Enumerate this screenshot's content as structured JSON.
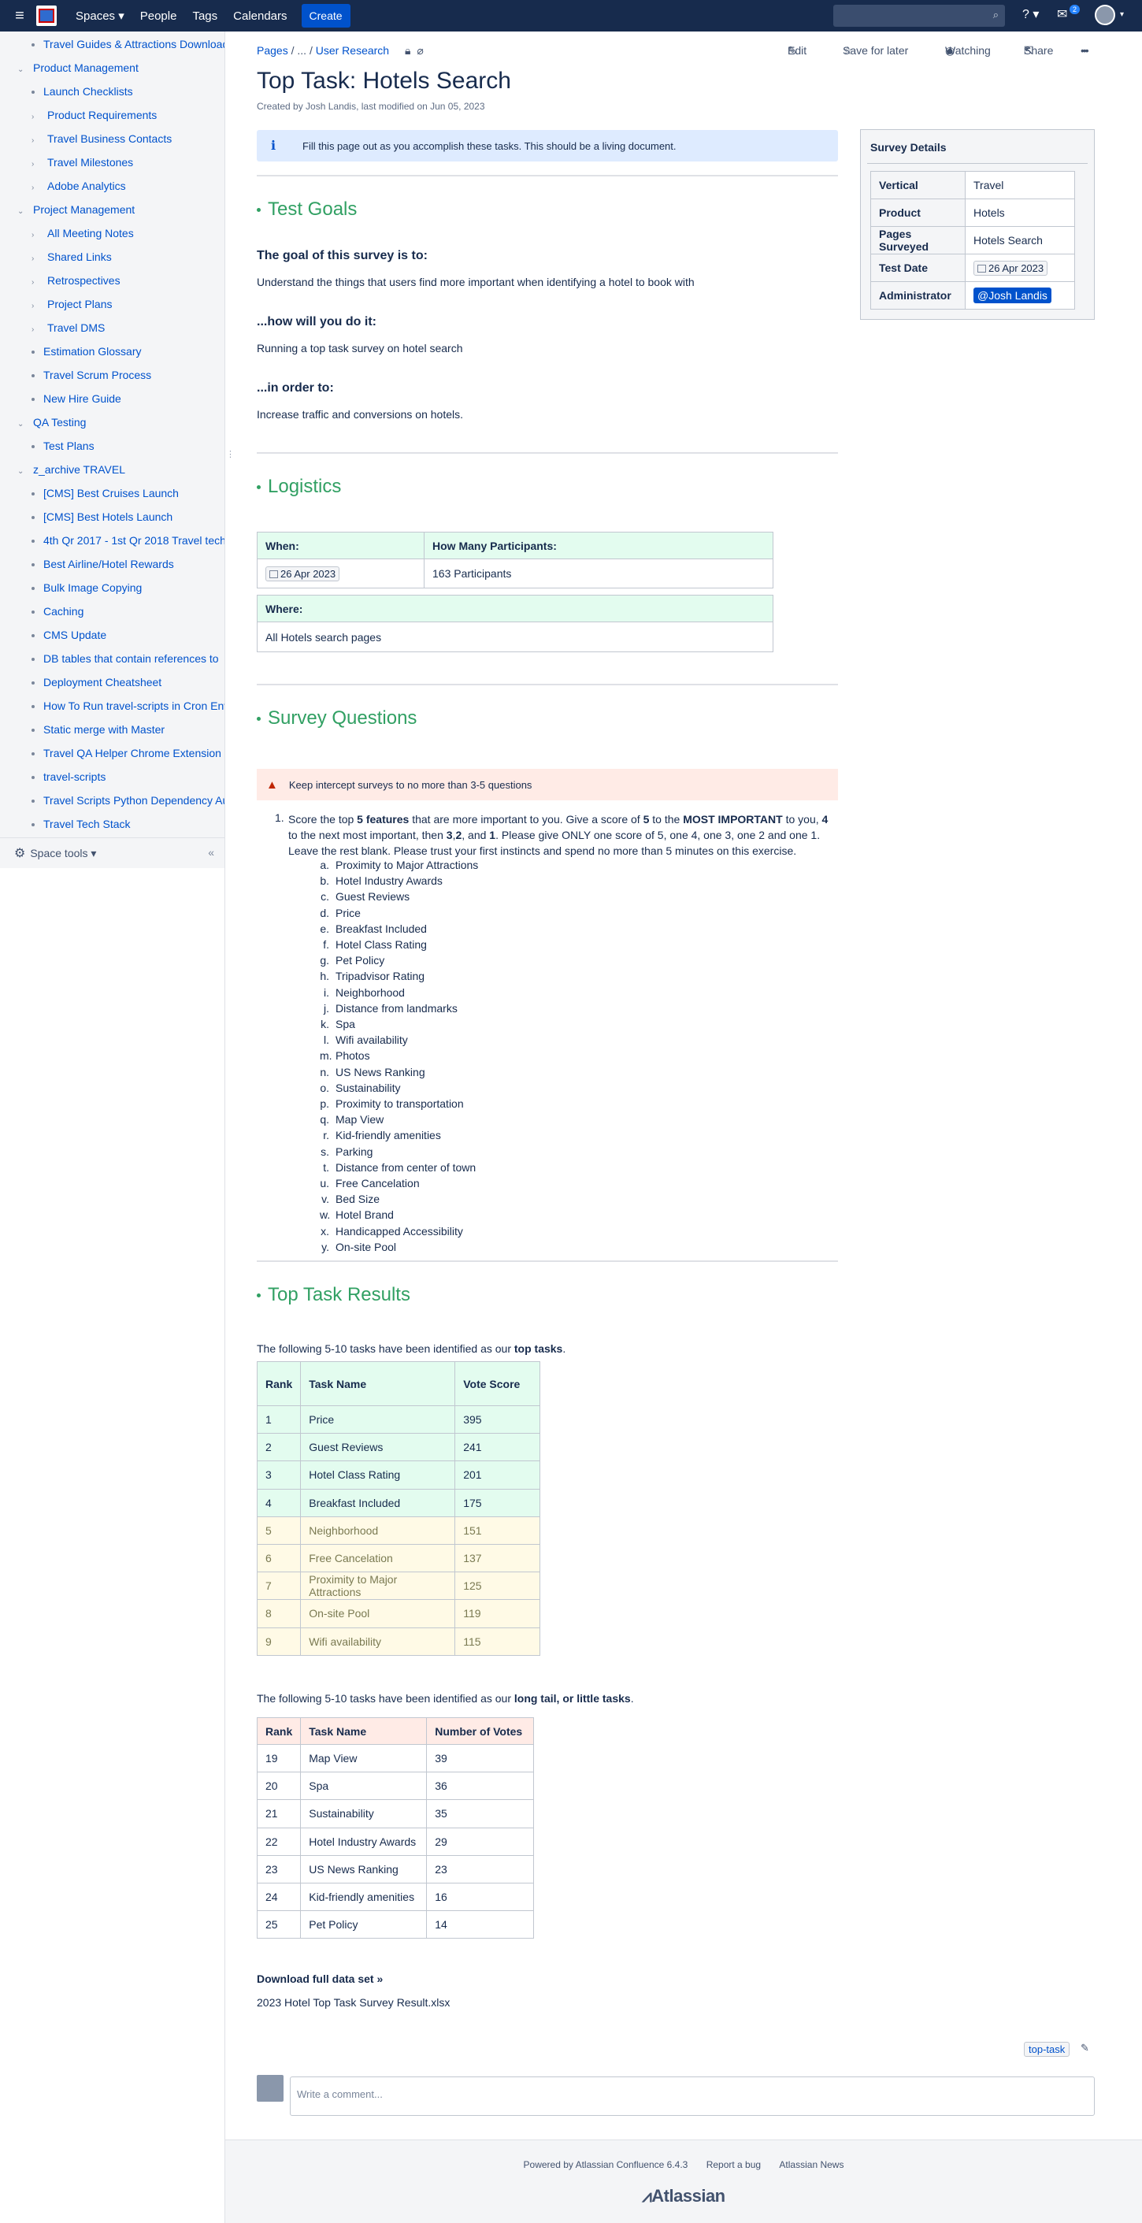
{
  "topbar": {
    "nav": [
      "Spaces ▾",
      "People",
      "Tags",
      "Calendars"
    ],
    "create_label": "Create",
    "notifications_count": "2",
    "help_label": "? ▾"
  },
  "sidebar": {
    "items": [
      {
        "label": "Travel Guides & Attractions Download",
        "level": 2,
        "kind": "bullet"
      },
      {
        "label": "Product Management",
        "level": 1,
        "kind": "open"
      },
      {
        "label": "Launch Checklists",
        "level": 2,
        "kind": "bullet"
      },
      {
        "label": "Product Requirements",
        "level": 2,
        "kind": "closed"
      },
      {
        "label": "Travel Business Contacts",
        "level": 2,
        "kind": "closed"
      },
      {
        "label": "Travel Milestones",
        "level": 2,
        "kind": "closed"
      },
      {
        "label": "Adobe Analytics",
        "level": 2,
        "kind": "closed"
      },
      {
        "label": "Project Management",
        "level": 1,
        "kind": "open"
      },
      {
        "label": "All Meeting Notes",
        "level": 2,
        "kind": "closed"
      },
      {
        "label": "Shared Links",
        "level": 2,
        "kind": "closed"
      },
      {
        "label": "Retrospectives",
        "level": 2,
        "kind": "closed"
      },
      {
        "label": "Project Plans",
        "level": 2,
        "kind": "closed"
      },
      {
        "label": "Travel DMS",
        "level": 2,
        "kind": "closed"
      },
      {
        "label": "Estimation Glossary",
        "level": 2,
        "kind": "bullet"
      },
      {
        "label": "Travel Scrum Process",
        "level": 2,
        "kind": "bullet"
      },
      {
        "label": "New Hire Guide",
        "level": 2,
        "kind": "bullet"
      },
      {
        "label": "QA Testing",
        "level": 1,
        "kind": "open"
      },
      {
        "label": "Test Plans",
        "level": 2,
        "kind": "bullet"
      },
      {
        "label": "z_archive TRAVEL",
        "level": 1,
        "kind": "open"
      },
      {
        "label": "[CMS] Best Cruises Launch",
        "level": 2,
        "kind": "bullet"
      },
      {
        "label": "[CMS] Best Hotels Launch",
        "level": 2,
        "kind": "bullet"
      },
      {
        "label": "4th Qr 2017 - 1st Qr 2018 Travel tech",
        "level": 2,
        "kind": "bullet"
      },
      {
        "label": "Best Airline/Hotel Rewards",
        "level": 2,
        "kind": "bullet"
      },
      {
        "label": "Bulk Image Copying",
        "level": 2,
        "kind": "bullet"
      },
      {
        "label": "Caching",
        "level": 2,
        "kind": "bullet"
      },
      {
        "label": "CMS Update",
        "level": 2,
        "kind": "bullet"
      },
      {
        "label": "DB tables that contain references to",
        "level": 2,
        "kind": "bullet"
      },
      {
        "label": "Deployment Cheatsheet",
        "level": 2,
        "kind": "bullet"
      },
      {
        "label": "How To Run travel-scripts in Cron Env",
        "level": 2,
        "kind": "bullet"
      },
      {
        "label": "Static merge with Master",
        "level": 2,
        "kind": "bullet"
      },
      {
        "label": "Travel QA Helper Chrome Extension",
        "level": 2,
        "kind": "bullet"
      },
      {
        "label": "travel-scripts",
        "level": 2,
        "kind": "bullet"
      },
      {
        "label": "Travel Scripts Python Dependency Au",
        "level": 2,
        "kind": "bullet"
      },
      {
        "label": "Travel Tech Stack",
        "level": 2,
        "kind": "bullet"
      }
    ],
    "space_tools": "Space tools ▾"
  },
  "page": {
    "breadcrumb": [
      "Pages",
      "...",
      "User Research"
    ],
    "actions": {
      "edit": "Edit",
      "save": "Save for later",
      "watching": "Watching",
      "share": "Share",
      "more": "•••"
    },
    "title": "Top Task: Hotels Search",
    "byline": "Created by Josh Landis, last modified on Jun 05, 2023",
    "info": "Fill this page out as you accomplish these tasks. This should be a living document.",
    "goals": {
      "heading": "Test Goals",
      "q1": "The goal of this survey is to:",
      "a1": "Understand the things that users find more important when identifying a hotel to book with",
      "q2": "...how will you do it:",
      "a2": "Running a top task survey on hotel search",
      "q3": "...in order to:",
      "a3": "Increase traffic and conversions on hotels."
    },
    "logistics": {
      "heading": "Logistics",
      "when_label": "When:",
      "participants_label": "How Many Participants:",
      "when_value": "26 Apr 2023",
      "participants_value": "163 Participants",
      "where_label": "Where:",
      "where_value": "All Hotels search pages"
    },
    "survey": {
      "heading": "Survey Questions",
      "warning": "Keep intercept surveys to no more than 3-5 questions",
      "q_number": "1.",
      "q_parts": [
        {
          "t": "Score the top ",
          "b": false
        },
        {
          "t": "5 features",
          "b": true
        },
        {
          "t": " that are more important to you. Give a score of ",
          "b": false
        },
        {
          "t": "5",
          "b": true
        },
        {
          "t": " to the ",
          "b": false
        },
        {
          "t": "MOST IMPORTANT",
          "b": true
        },
        {
          "t": " to you, ",
          "b": false
        },
        {
          "t": "4",
          "b": true
        },
        {
          "t": " to the next most important, then ",
          "b": false
        },
        {
          "t": "3",
          "b": true
        },
        {
          "t": ",",
          "b": false
        },
        {
          "t": "2",
          "b": true
        },
        {
          "t": ", and ",
          "b": false
        },
        {
          "t": "1",
          "b": true
        },
        {
          "t": ". Please give ONLY one score of 5, one 4, one 3, one 2 and one 1.  Leave the rest blank. Please trust your first instincts and spend no more than  5 minutes on this exercise.",
          "b": false
        }
      ],
      "letters": [
        "a.",
        "b.",
        "c.",
        "d.",
        "e.",
        "f.",
        "g.",
        "h.",
        "i.",
        "j.",
        "k.",
        "l.",
        "m.",
        "n.",
        "o.",
        "p.",
        "q.",
        "r.",
        "s.",
        "t.",
        "u.",
        "v.",
        "w.",
        "x.",
        "y."
      ],
      "options": [
        "Proximity to Major Attractions",
        "Hotel Industry Awards",
        "Guest Reviews",
        "Price",
        "Breakfast Included",
        "Hotel Class Rating",
        "Pet Policy",
        "Tripadvisor Rating",
        "Neighborhood",
        "Distance from landmarks",
        "Spa",
        "Wifi availability",
        "Photos",
        "US News Ranking",
        "Sustainability",
        "Proximity to transportation",
        "Map View",
        "Kid-friendly amenities",
        "Parking",
        "Distance from center of town",
        "Free Cancelation",
        "Bed Size",
        "Hotel Brand",
        "Handicapped Accessibility",
        "On-site Pool"
      ]
    },
    "results": {
      "heading": "Top Task Results",
      "intro_pre": "The following 5-10 tasks have been identified as our ",
      "intro_bold": "top tasks",
      "intro_post": ".",
      "cols": [
        "Rank",
        "Task Name",
        "Vote Score"
      ],
      "rows": [
        [
          "1",
          "Price",
          "395"
        ],
        [
          "2",
          "Guest Reviews",
          "241"
        ],
        [
          "3",
          "Hotel Class Rating",
          "201"
        ],
        [
          "4",
          "Breakfast Included",
          "175"
        ],
        [
          "5",
          "Neighborhood",
          "151"
        ],
        [
          "6",
          "Free Cancelation",
          "137"
        ],
        [
          "7",
          "Proximity to Major Attractions",
          "125"
        ],
        [
          "8",
          "On-site Pool",
          "119"
        ],
        [
          "9",
          "Wifi availability",
          "115"
        ]
      ],
      "tail_pre": "The following 5-10 tasks have been identified as our ",
      "tail_bold": "long tail, or little tasks",
      "tail_post": ".",
      "tail_cols": [
        "Rank",
        "Task Name",
        "Number of Votes"
      ],
      "tail_rows": [
        [
          "19",
          "Map View",
          "39"
        ],
        [
          "20",
          "Spa",
          "36"
        ],
        [
          "21",
          "Sustainability",
          "35"
        ],
        [
          "22",
          "Hotel Industry Awards",
          "29"
        ],
        [
          "23",
          "US News Ranking",
          "23"
        ],
        [
          "24",
          "Kid-friendly amenities",
          "16"
        ],
        [
          "25",
          "Pet Policy",
          "14"
        ]
      ],
      "download_heading": "Download full data set »",
      "download_file": "2023 Hotel Top Task Survey Result.xlsx"
    },
    "label_tag": "top-task",
    "comment_placeholder": "Write a comment..."
  },
  "survey_details": {
    "title": "Survey Details",
    "rows": [
      {
        "k": "Vertical",
        "v": "Travel"
      },
      {
        "k": "Product",
        "v": "Hotels"
      },
      {
        "k": "Pages Surveyed",
        "v": "Hotels Search"
      },
      {
        "k": "Test Date",
        "v": "26 Apr 2023"
      },
      {
        "k": "Administrator",
        "v": "@Josh Landis"
      }
    ]
  },
  "footer": {
    "links": [
      "Powered by Atlassian Confluence 6.4.3",
      "Report a bug",
      "Atlassian News"
    ],
    "brand": "Atlassian"
  },
  "colors": {
    "header": "#172b4d",
    "accent": "#0052cc",
    "heading_green": "#31a063"
  }
}
